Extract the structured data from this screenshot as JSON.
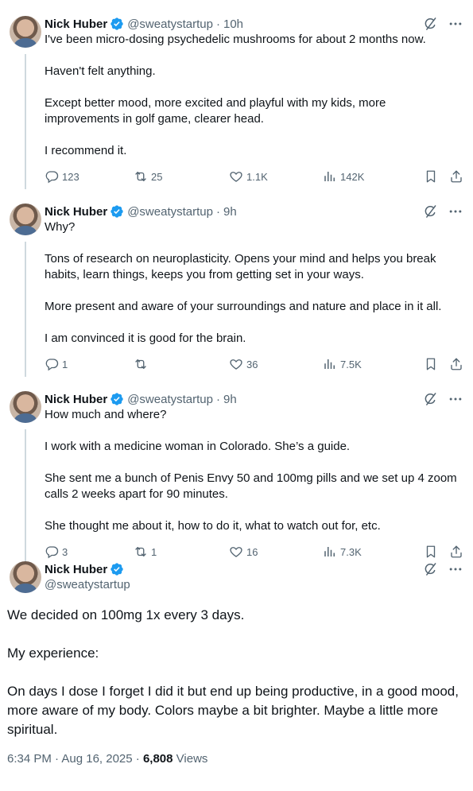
{
  "author": {
    "name": "Nick Huber",
    "handle": "@sweatystartup"
  },
  "colors": {
    "verified": "#1d9bf0",
    "text": "#0f1419",
    "secondary": "#536471",
    "thread_line": "#cfd9de"
  },
  "tweets": [
    {
      "time": "10h",
      "paragraphs": [
        "I've been micro-dosing psychedelic mushrooms for about 2 months now.",
        "Haven't felt anything.",
        "Except better mood, more excited and playful with my kids, more improvements in golf game, clearer head.",
        "I recommend it."
      ],
      "replies": "123",
      "reposts": "25",
      "likes": "1.1K",
      "views": "142K"
    },
    {
      "time": "9h",
      "paragraphs": [
        "Why?",
        "Tons of research on neuroplasticity. Opens your mind and helps you break habits, learn things, keeps you from getting set in your ways.",
        "More present and aware of your surroundings and nature and place in it all.",
        "I am convinced it is good for the brain."
      ],
      "replies": "1",
      "reposts": "",
      "likes": "36",
      "views": "7.5K"
    },
    {
      "time": "9h",
      "paragraphs": [
        "How much and where?",
        "I work with a medicine woman in Colorado. She’s a guide.",
        "She sent me a bunch of Penis Envy 50 and 100mg pills and we set up 4 zoom calls 2 weeks apart for 90 minutes.",
        "She thought me about it, how to do it, what to watch out for, etc."
      ],
      "replies": "3",
      "reposts": "1",
      "likes": "16",
      "views": "7.3K"
    }
  ],
  "main": {
    "paragraphs": [
      "We decided on 100mg 1x every 3 days.",
      "My experience:",
      "On days I dose I forget I did it but end up being productive, in a good mood, more aware of my body. Colors maybe a bit brighter. Maybe a little more spiritual."
    ],
    "timestamp": "6:34 PM · Aug 16, 2025 · ",
    "views_count": "6,808",
    "views_label": " Views"
  },
  "icons": {
    "verified": "verified-badge-icon",
    "grok": "grok-icon",
    "more": "more-icon",
    "reply": "reply-icon",
    "repost": "repost-icon",
    "like": "heart-icon",
    "views": "views-icon",
    "bookmark": "bookmark-icon",
    "share": "share-icon"
  }
}
